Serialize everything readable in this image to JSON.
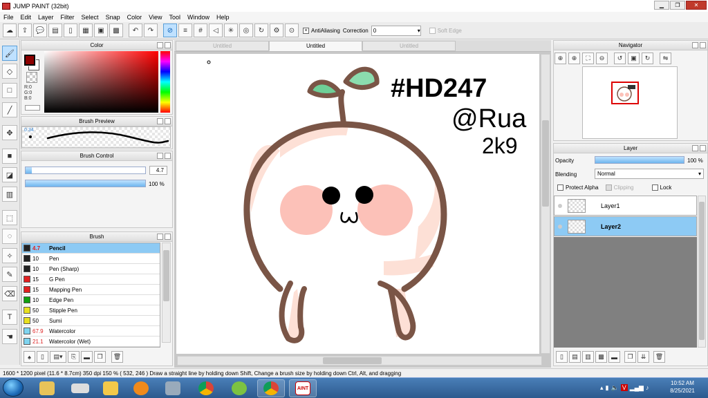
{
  "window": {
    "title": "JUMP PAINT (32bit)"
  },
  "menu": [
    "File",
    "Edit",
    "Layer",
    "Filter",
    "Select",
    "Snap",
    "Color",
    "View",
    "Tool",
    "Window",
    "Help"
  ],
  "toolbar": {
    "antialiasing_label": "AntiAliasing",
    "correction_label": "Correction",
    "correction_value": "0",
    "soft_edge_label": "Soft Edge"
  },
  "panels": {
    "color": {
      "title": "Color",
      "r": "R:0",
      "g": "G:0",
      "b": "B:0"
    },
    "brush_preview": {
      "title": "Brush Preview",
      "size": "0.34"
    },
    "brush_control": {
      "title": "Brush Control",
      "size_value": "4.7",
      "opacity_value": "100 %",
      "size_fraction": 0.05,
      "opacity_fraction": 1.0
    },
    "brush": {
      "title": "Brush",
      "items": [
        {
          "size": "4.7",
          "name": "Pencil",
          "color": "#222222",
          "size_color": "#d22",
          "selected": true
        },
        {
          "size": "10",
          "name": "Pen",
          "color": "#222222",
          "size_color": "#000"
        },
        {
          "size": "10",
          "name": "Pen (Sharp)",
          "color": "#222222",
          "size_color": "#000"
        },
        {
          "size": "15",
          "name": "G Pen",
          "color": "#e02020",
          "size_color": "#000"
        },
        {
          "size": "15",
          "name": "Mapping Pen",
          "color": "#e02020",
          "size_color": "#000"
        },
        {
          "size": "10",
          "name": "Edge Pen",
          "color": "#10a010",
          "size_color": "#000"
        },
        {
          "size": "50",
          "name": "Stipple Pen",
          "color": "#e8e020",
          "size_color": "#000"
        },
        {
          "size": "50",
          "name": "Sumi",
          "color": "#e8e020",
          "size_color": "#000"
        },
        {
          "size": "67.9",
          "name": "Watercolor",
          "color": "#7fd4f0",
          "size_color": "#d22"
        },
        {
          "size": "21.1",
          "name": "Watercolor (Wet)",
          "color": "#7fd4f0",
          "size_color": "#d22"
        }
      ]
    },
    "navigator": {
      "title": "Navigator"
    },
    "layer": {
      "title": "Layer",
      "opacity_label": "Opacity",
      "opacity_value": "100 %",
      "opacity_fraction": 1.0,
      "blending_label": "Blending",
      "blending_value": "Normal",
      "protect_alpha": "Protect Alpha",
      "clipping": "Clipping",
      "lock": "Lock",
      "layers": [
        {
          "name": "Layer1"
        },
        {
          "name": "Layer2",
          "selected": true
        }
      ]
    }
  },
  "canvas": {
    "tabs": [
      {
        "label": "Untitled"
      },
      {
        "label": "Untitled",
        "active": true
      },
      {
        "label": "Untitled"
      }
    ],
    "drawing_text": {
      "line1": "#HD247",
      "line2": "@Rua",
      "line3": "2k9"
    }
  },
  "status": {
    "text": "1600 * 1200 pixel  (11.6 * 8.7cm)  350 dpi  150 %  ( 532, 246 )  Draw a straight line by holding down Shift, Change a brush size by holding down Ctrl, Alt, and dragging"
  },
  "taskbar": {
    "time": "10:52 AM",
    "date": "8/25/2021",
    "active_app_label": "AINT"
  },
  "colors": {
    "accent": "#8dcaf4",
    "foreground": "#8b0000",
    "titlebar_close": "#c0392b"
  }
}
